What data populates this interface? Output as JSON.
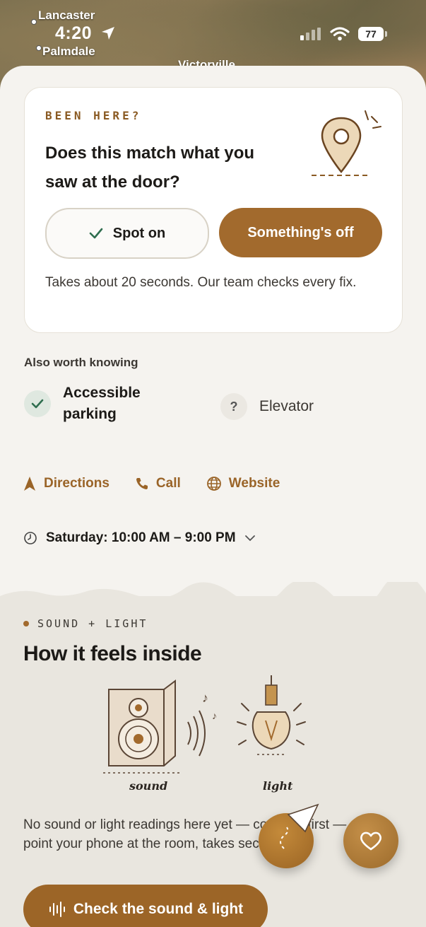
{
  "status": {
    "time": "4:20",
    "battery": "77"
  },
  "map": {
    "labels": [
      "Lancaster",
      "Palmdale",
      "Victorville"
    ]
  },
  "card": {
    "eyebrow": "BEEN HERE?",
    "question": "Does this match what you saw at the door?",
    "spot_on_label": "Spot on",
    "something_off_label": "Something's off",
    "note": "Takes about 20 seconds. Our team checks every fix."
  },
  "also": {
    "title": "Also worth knowing",
    "features": [
      {
        "label": "Accessible parking",
        "status": "yes"
      },
      {
        "label": "Elevator",
        "status": "unknown"
      }
    ]
  },
  "actions": {
    "directions": "Directions",
    "call": "Call",
    "website": "Website"
  },
  "hours": {
    "text": "Saturday: 10:00 AM – 9:00 PM"
  },
  "sound_light": {
    "eyebrow": "SOUND + LIGHT",
    "title": "How it feels inside",
    "sound_caption": "sound",
    "light_caption": "light",
    "note": "No sound or light readings here yet — could be first — point your phone at the room, takes seconds.",
    "cta_label": "Check the sound & light"
  },
  "colors": {
    "accent": "#a26a2d",
    "check_green": "#2f6e4f"
  }
}
